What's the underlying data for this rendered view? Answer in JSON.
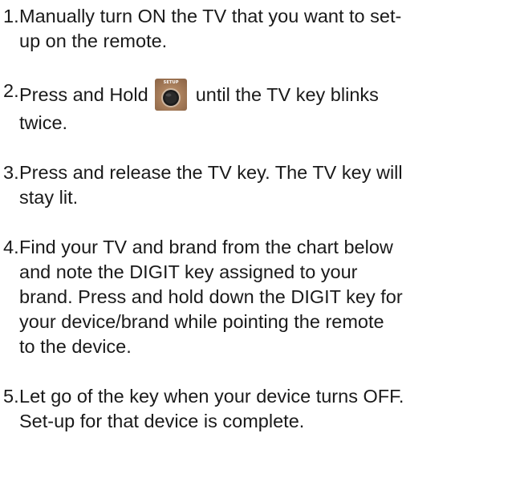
{
  "steps": [
    {
      "number": "1.",
      "lines": [
        "Manually turn ON the TV that you want to set-",
        "up on the remote."
      ]
    },
    {
      "number": "2.",
      "line1_before": "Press and Hold",
      "line1_after": "until the TV key blinks",
      "line2": "twice.",
      "icon": {
        "name": "setup-button-icon",
        "label": "SETUP"
      }
    },
    {
      "number": "3.",
      "lines": [
        "Press and release the TV key.  The TV key will",
        "stay lit."
      ]
    },
    {
      "number": "4.",
      "lines": [
        "Find your TV and brand from the chart below",
        "and note the DIGIT key assigned to your",
        "brand.  Press and hold down the DIGIT key for",
        "your device/brand while pointing the remote",
        "to the device."
      ]
    },
    {
      "number": "5.",
      "lines": [
        "Let go of the key when your device turns OFF.",
        "Set-up for that device is complete."
      ]
    }
  ]
}
